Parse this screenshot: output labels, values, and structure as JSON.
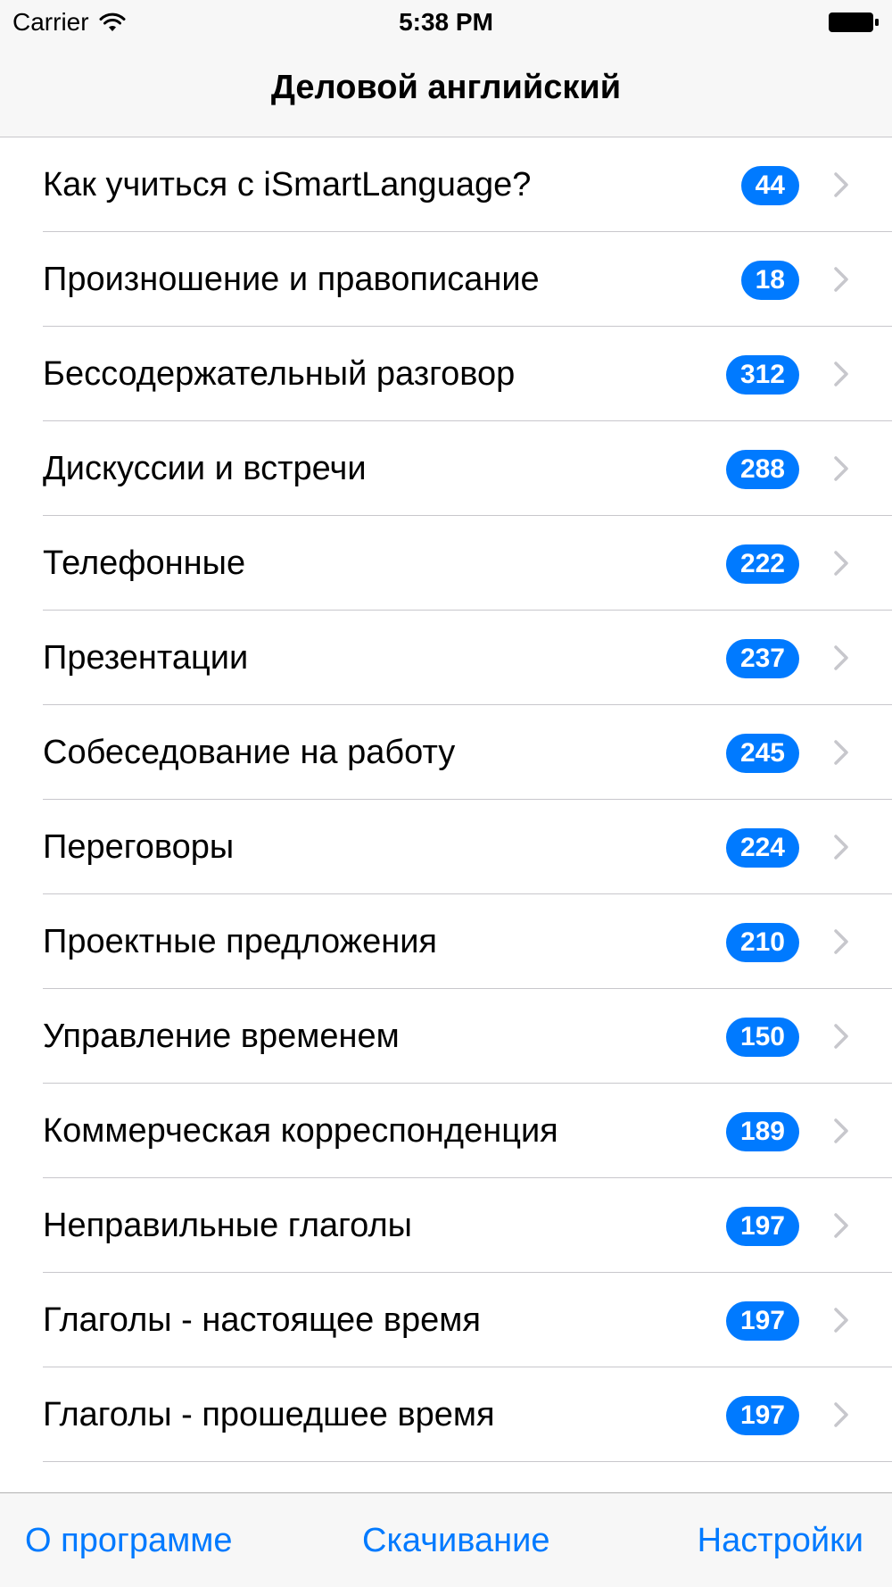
{
  "status_bar": {
    "carrier": "Carrier",
    "time": "5:38 PM",
    "wifi_icon": "wifi-icon",
    "battery_icon": "battery-icon"
  },
  "nav": {
    "title": "Деловой английский"
  },
  "colors": {
    "accent": "#007aff",
    "separator": "#c8c7cc",
    "bar_background": "#f7f7f7",
    "chevron": "#c7c7cc"
  },
  "list": {
    "items": [
      {
        "label": "Как учиться с iSmartLanguage?",
        "count": "44"
      },
      {
        "label": "Произношение и правописание",
        "count": "18"
      },
      {
        "label": "Бессодержательный разговор",
        "count": "312"
      },
      {
        "label": "Дискуссии и встречи",
        "count": "288"
      },
      {
        "label": "Телефонные",
        "count": "222"
      },
      {
        "label": "Презентации",
        "count": "237"
      },
      {
        "label": "Собеседование на работу",
        "count": "245"
      },
      {
        "label": "Переговоры",
        "count": "224"
      },
      {
        "label": "Проектные предложения",
        "count": "210"
      },
      {
        "label": "Управление временем",
        "count": "150"
      },
      {
        "label": "Коммерческая корреспонденция",
        "count": "189"
      },
      {
        "label": "Неправильные глаголы",
        "count": "197"
      },
      {
        "label": "Глаголы - настоящее время",
        "count": "197"
      },
      {
        "label": "Глаголы - прошедшее время",
        "count": "197"
      }
    ]
  },
  "toolbar": {
    "about_label": "О программе",
    "download_label": "Скачивание",
    "settings_label": "Настройки"
  }
}
